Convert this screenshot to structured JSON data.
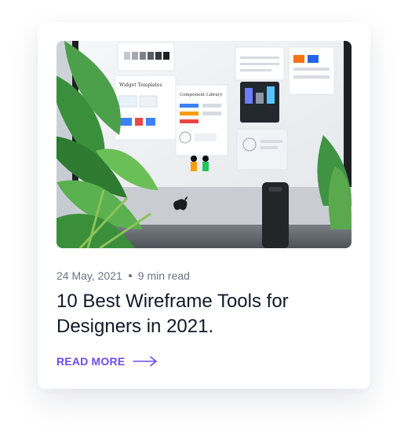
{
  "card": {
    "image_alt": "Desktop monitor showing design wireframe templates behind plant leaves",
    "screen_labels": {
      "widget_templates": "Widget Templates",
      "component_library": "Component Library"
    },
    "date": "24 May, 2021",
    "read_time": "9 min read",
    "title": "10 Best Wireframe Tools for Designers in 2021.",
    "cta_label": "READ MORE",
    "cta_icon": "arrow-right-icon"
  },
  "colors": {
    "accent": "#6c4cf1",
    "title": "#111827",
    "meta": "#6b7280"
  }
}
